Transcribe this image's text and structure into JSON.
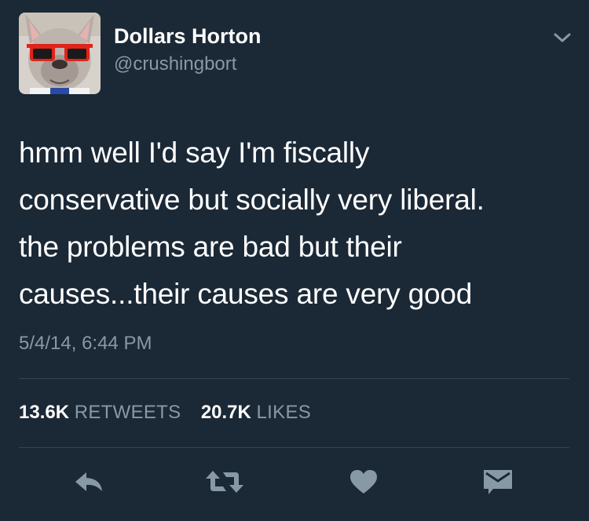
{
  "user": {
    "display_name": "Dollars Horton",
    "handle": "@crushingbort",
    "avatar_icon": "french-bulldog-red-sunglasses-avatar"
  },
  "tweet": {
    "text_lines": [
      "hmm well I'd say I'm fiscally",
      "conservative but socially very liberal.",
      "the problems are bad but their",
      "causes...their causes are very good"
    ],
    "timestamp": "5/4/14, 6:44 PM"
  },
  "stats": {
    "retweets_count": "13.6K",
    "retweets_label": "RETWEETS",
    "likes_count": "20.7K",
    "likes_label": "LIKES"
  },
  "actions": {
    "icons": [
      "reply-icon",
      "retweet-icon",
      "heart-icon",
      "direct-message-icon"
    ]
  },
  "colors": {
    "background": "#1b2836",
    "primary_text": "#ffffff",
    "secondary_text": "#8899a6",
    "icon": "#8899a6",
    "divider": "#38444d",
    "sunglasses": "#e2231a"
  }
}
